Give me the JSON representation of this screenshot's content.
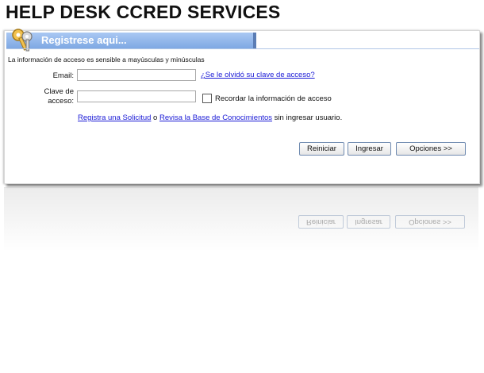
{
  "title": "HELP DESK CCRED SERVICES",
  "panel": {
    "header_label": "Registrese aqui...",
    "case_note": "La información de acceso es sensible a mayúsculas y minúsculas"
  },
  "form": {
    "email_label": "Email:",
    "email_value": "",
    "forgot_link": "¿Se le olvidó su clave de acceso?",
    "password_label_line1": "Clave de",
    "password_label_line2": "acceso:",
    "password_value": "",
    "remember_label": "Recordar la información de acceso",
    "register_link": "Registra una Solicitud",
    "conjunction": " o ",
    "kb_link": "Revisa la Base de Conocimientos",
    "suffix_text": " sin ingresar usuario."
  },
  "buttons": {
    "reset": "Reiniciar",
    "login": "Ingresar",
    "options": "Opciones >>"
  },
  "colors": {
    "header_blue": "#7fa8e3",
    "link_blue": "#1a1ad6"
  }
}
